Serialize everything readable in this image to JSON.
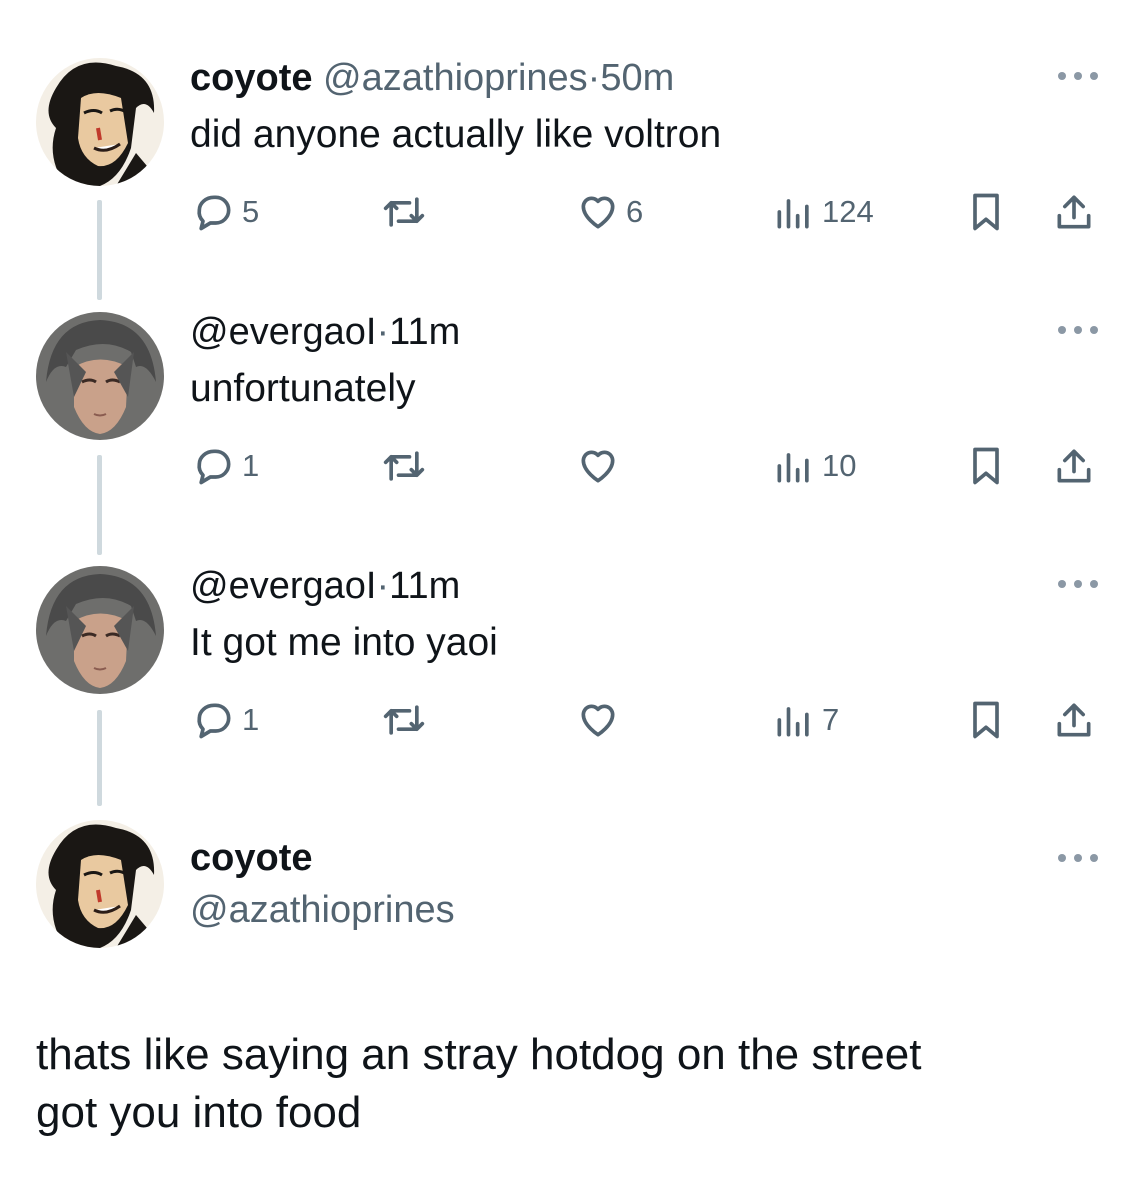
{
  "tweets": [
    {
      "name": "coyote",
      "handle": "@azathioprines",
      "separator": "·",
      "time": "50m",
      "text": "did anyone actually like voltron",
      "replies": "5",
      "likes": "6",
      "views": "124"
    },
    {
      "name": "",
      "handle": "@evergaoI",
      "separator": "·",
      "time": "11m",
      "text": "unfortunately",
      "replies": "1",
      "likes": "",
      "views": "10"
    },
    {
      "name": "",
      "handle": "@evergaoI",
      "separator": "·",
      "time": "11m",
      "text": "It got me into yaoi",
      "replies": "1",
      "likes": "",
      "views": "7"
    }
  ],
  "main_tweet": {
    "name": "coyote",
    "handle": "@azathioprines",
    "text_line1": "thats like saying an stray hotdog on the street",
    "text_line2": "got you into food"
  },
  "icons": {
    "reply": "speech-bubble-icon",
    "retweet": "retweet-arrows-icon",
    "like": "heart-icon",
    "views": "bar-chart-icon",
    "bookmark": "bookmark-icon",
    "share": "share-upload-icon",
    "more": "ellipsis-icon"
  },
  "colors": {
    "text": "#0f1419",
    "secondary": "#536471",
    "thread_line": "#cfd9de"
  }
}
